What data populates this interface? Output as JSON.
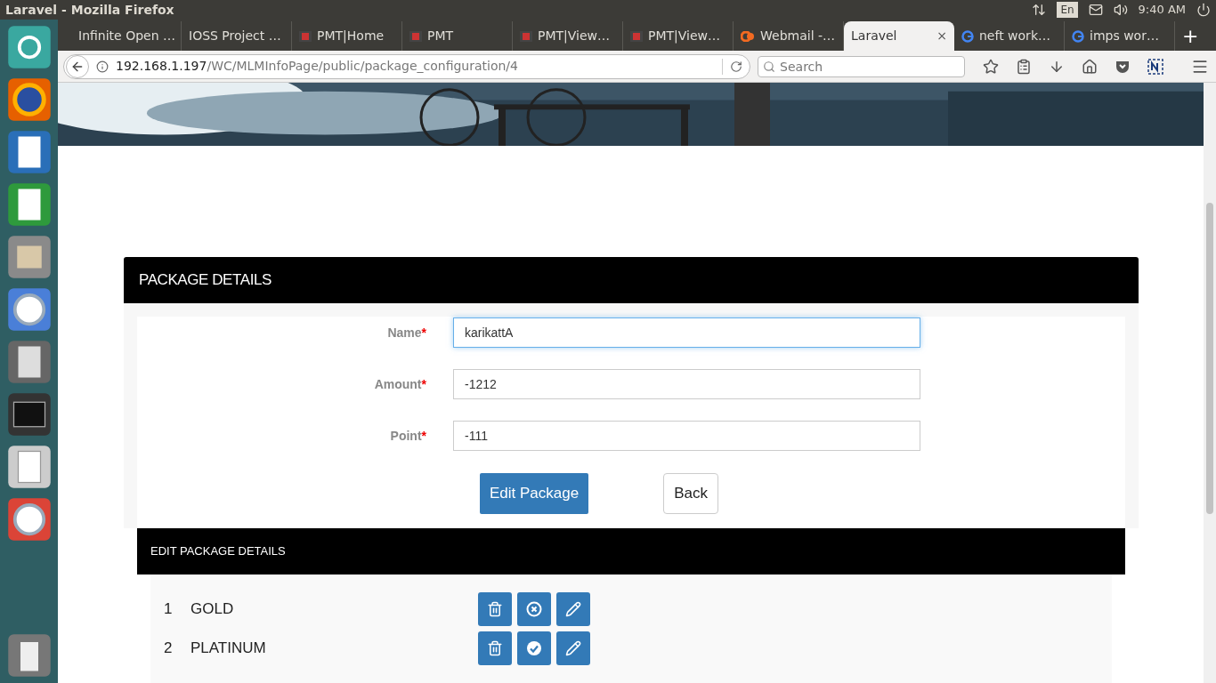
{
  "window": {
    "title": "Laravel - Mozilla Firefox"
  },
  "top_bar": {
    "keyboard": "En",
    "time": "9:40 AM"
  },
  "launcher": [
    {
      "kind": "dash",
      "color": "#3aa8a0"
    },
    {
      "kind": "fox",
      "color": "#e66000"
    },
    {
      "kind": "doc",
      "color": "#2a6fb8"
    },
    {
      "kind": "sheet",
      "color": "#2e9a3c"
    },
    {
      "kind": "files",
      "color": "#8a8a8a"
    },
    {
      "kind": "circle",
      "color": "#4a7fd8"
    },
    {
      "kind": "calc",
      "color": "#666666"
    },
    {
      "kind": "term",
      "color": "#333333"
    },
    {
      "kind": "editor",
      "color": "#cccccc"
    },
    {
      "kind": "circle",
      "color": "#db4437"
    },
    {
      "kind": "trash",
      "color": "#777777"
    }
  ],
  "tabs": [
    {
      "label": "Infinite Open …",
      "kind": "plain",
      "selected": false
    },
    {
      "label": "IOSS Project …",
      "kind": "plain",
      "selected": false
    },
    {
      "label": "PMT|Home",
      "kind": "pmt",
      "selected": false
    },
    {
      "label": "PMT",
      "kind": "pmt",
      "selected": false
    },
    {
      "label": "PMT|View…",
      "kind": "pmt",
      "selected": false
    },
    {
      "label": "PMT|View…",
      "kind": "pmt",
      "selected": false
    },
    {
      "label": "Webmail -…",
      "kind": "webmail",
      "selected": false
    },
    {
      "label": "Laravel",
      "kind": "plain",
      "selected": true,
      "close": "×"
    },
    {
      "label": "neft work…",
      "kind": "google",
      "selected": false
    },
    {
      "label": "imps wor…",
      "kind": "google",
      "selected": false
    }
  ],
  "new_tab": "+",
  "url": {
    "host": "192.168.1.197",
    "path": "/WC/MLMInfoPage/public/package_configuration/4"
  },
  "search": {
    "placeholder": "Search"
  },
  "form": {
    "title": "PACKAGE DETAILS",
    "required_mark": "*",
    "fields": [
      {
        "label": "Name",
        "value": "karikattA",
        "focused": true
      },
      {
        "label": "Amount",
        "value": "-1212",
        "focused": false
      },
      {
        "label": "Point",
        "value": "-111",
        "focused": false
      }
    ],
    "submit": "Edit Package",
    "back": "Back"
  },
  "list": {
    "title": "EDIT PACKAGE DETAILS",
    "rows": [
      {
        "number": "1",
        "name": "GOLD",
        "active": false
      },
      {
        "number": "2",
        "name": "PLATINUM",
        "active": true
      }
    ]
  }
}
